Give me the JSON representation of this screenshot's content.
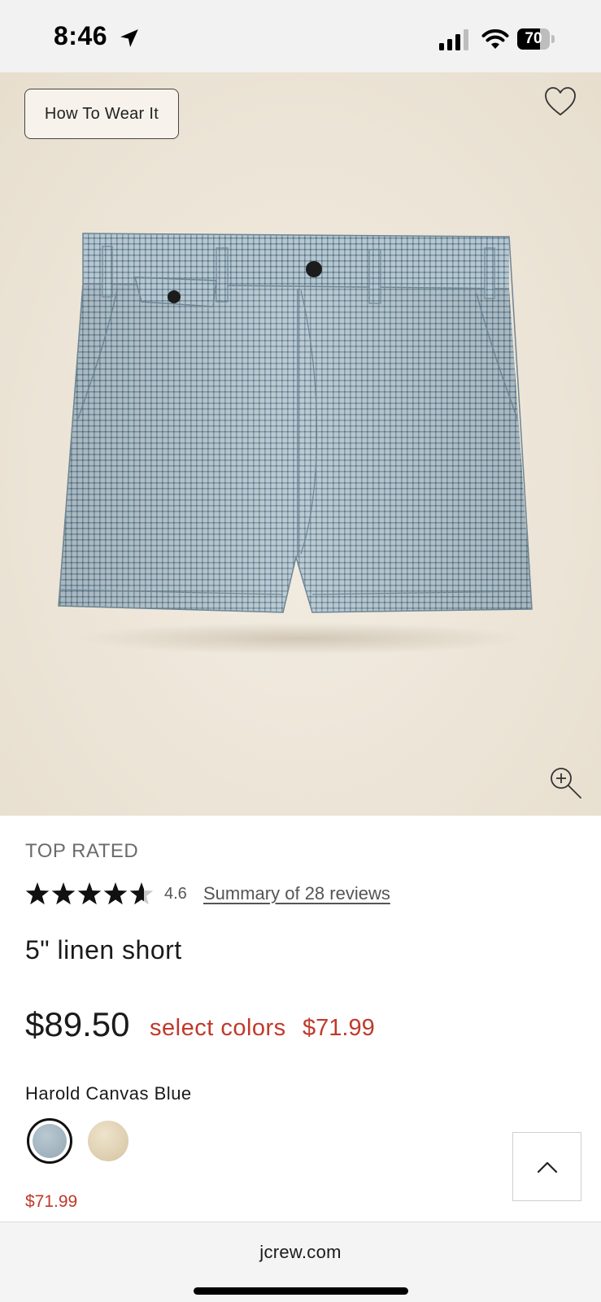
{
  "status_bar": {
    "time": "8:46",
    "battery_level": "70",
    "battery_fraction": 0.7
  },
  "hero": {
    "how_to_wear_label": "How To Wear It",
    "background_color": "#ece4d6"
  },
  "product": {
    "badge": "TOP RATED",
    "rating": 4.6,
    "rating_text": "4.6",
    "reviews_link": "Summary of 28 reviews",
    "name": "5\" linen short",
    "price": "$89.50",
    "sale_label": "select colors",
    "sale_price": "$71.99",
    "selected_color": "Harold Canvas Blue",
    "swatch_price": "$71.99",
    "swatches": [
      {
        "name": "Harold Canvas Blue",
        "selected": true,
        "color": "#a7b8c3"
      },
      {
        "name": "beige",
        "selected": false,
        "color": "#dccdae"
      }
    ]
  },
  "browser": {
    "url": "jcrew.com"
  },
  "colors": {
    "sale_red": "#c0392b",
    "text_dark": "#1a1a1a",
    "muted_gray": "#6b6b6b"
  },
  "icons": [
    "location-arrow-icon",
    "signal-icon",
    "wifi-icon",
    "battery-icon",
    "heart-icon",
    "zoom-in-icon",
    "star-icon",
    "chevron-up-icon"
  ]
}
